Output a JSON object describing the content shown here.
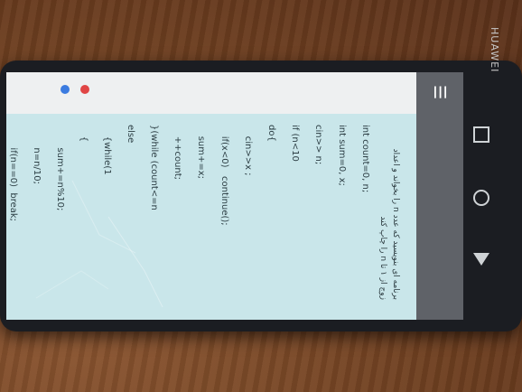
{
  "device": {
    "brand": "HUAWEI"
  },
  "app": {
    "menu_icon": "hamburger-icon"
  },
  "question_text": "برنامه ای بنویسید که عدد n را بخواند و اعداد زوج از ۱ تا n را چاپ کند",
  "code_lines": [
    "int count=0, n;",
    "int sum=0, x;",
    "cin>> n;",
    "if (n<10",
    "do{",
    "    cin>>x ;",
    "    if(x<0)   continue();",
    "    sum+=x;",
    "    ++count;",
    "}(while (count<=n",
    "else",
    "    {while(1",
    "    {",
    "        sum+=n%10;",
    "        n=n/10;",
    "        if(n==0)  break;"
  ],
  "colors": {
    "code_bg": "#c9e6ea",
    "top_bar": "#5f6268"
  }
}
